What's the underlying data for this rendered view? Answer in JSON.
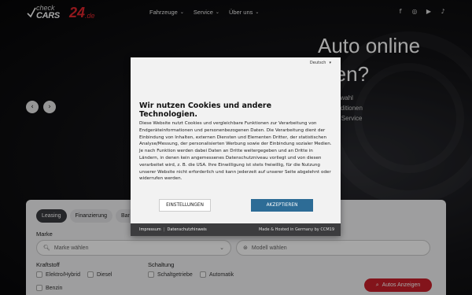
{
  "brand": {
    "logo_line1": "check",
    "logo_line2": "CARS",
    "logo_number": "24",
    "logo_tld": ".de"
  },
  "nav": {
    "items": [
      {
        "label": "Fahrzeuge"
      },
      {
        "label": "Service"
      },
      {
        "label": "Über uns"
      }
    ]
  },
  "socials": [
    "facebook-icon",
    "instagram-icon",
    "youtube-icon",
    "tiktok-icon"
  ],
  "hero": {
    "title_line1": "Auto online",
    "title_line2": "ufen?",
    "sub_line1": "tige Auswahl",
    "sub_line2": "tive Konditionen",
    "sub_line3": "lässiger Service"
  },
  "search": {
    "tabs": [
      "Leasing",
      "Finanzierung",
      "Bar"
    ],
    "marke_label": "Marke",
    "marke_placeholder": "Marke wählen",
    "modell_placeholder": "Modell wählen",
    "kraftstoff_label": "Kraftstoff",
    "kraftstoff_options": [
      "Elektro/Hybrid",
      "Diesel",
      "Benzin"
    ],
    "schaltung_label": "Schaltung",
    "schaltung_options": [
      "Schaltgetriebe",
      "Automatik"
    ],
    "cta_label": "Autos Anzeigen"
  },
  "cookie": {
    "language": "Deutsch",
    "title": "Wir nutzen Cookies und andere Technologien.",
    "text": "Diese Website nutzt Cookies und vergleichbare Funktionen zur Verarbeitung von Endgeräteinformationen und personenbezogenen Daten. Die Verarbeitung dient der Einbindung von Inhalten, externen Diensten und Elementen Dritter, der statistischen Analyse/Messung, der personalisierten Werbung sowie der Einbindung sozialer Medien. Je nach Funktion werden dabei Daten an Dritte weitergegeben und an Dritte in Ländern, in denen kein angemessenes Datenschutzniveau vorliegt und von diesen verarbeitet wird, z. B. die USA. Ihre Einwilligung ist stets freiwillig, für die Nutzung unserer Website nicht erforderlich und kann jederzeit auf unserer Seite abgelehnt oder widerrufen werden.",
    "settings_label": "EINSTELLUNGEN",
    "accept_label": "AKZEPTIEREN",
    "impressum": "Impressum",
    "separator": "|",
    "datenschutz": "Datenschutzhinweis",
    "hosted": "Made & Hosted in Germany by CCM19"
  },
  "colors": {
    "accent_red": "#c9202a",
    "accept_blue": "#2d6c96"
  }
}
